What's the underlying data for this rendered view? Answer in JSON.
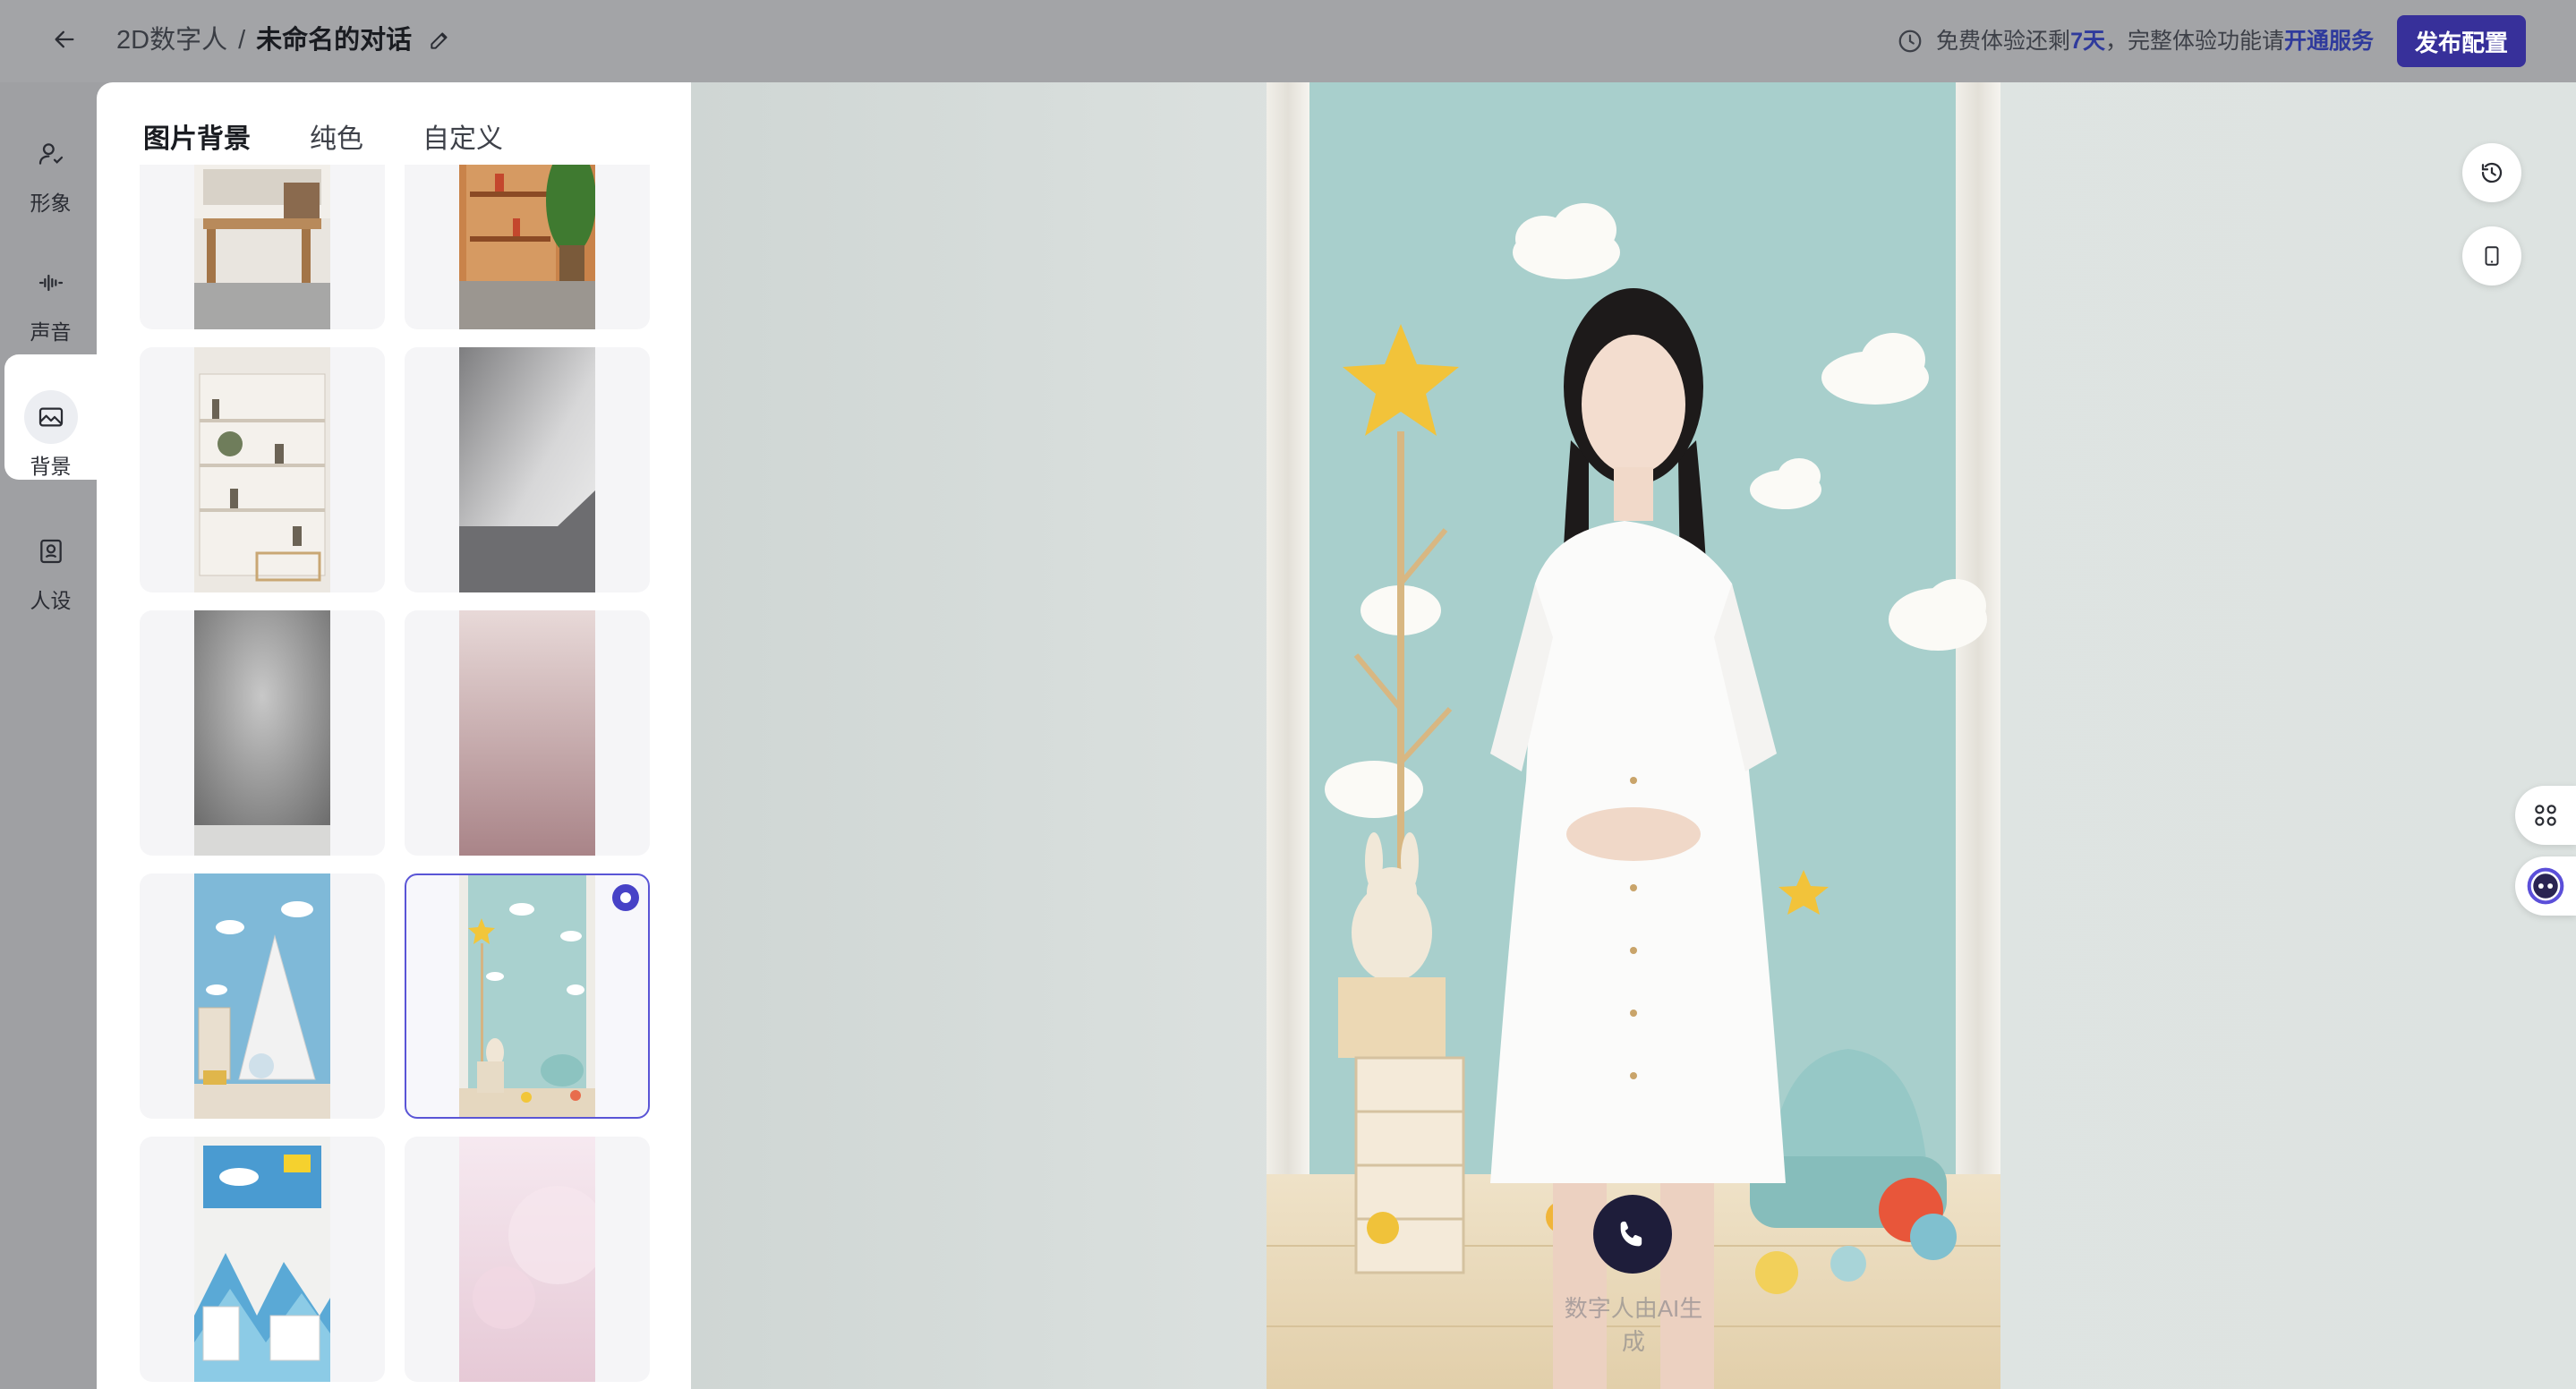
{
  "header": {
    "breadcrumb_parent": "2D数字人",
    "breadcrumb_sep": "/",
    "breadcrumb_current": "未命名的对话",
    "trial_prefix": "免费体验还剩",
    "trial_days": "7天",
    "trial_middle": "，完整体验功能请",
    "trial_link": "开通服务",
    "publish_label": "发布配置"
  },
  "sidebar": {
    "items": [
      {
        "label": "形象",
        "icon": "person-icon"
      },
      {
        "label": "声音",
        "icon": "waveform-icon"
      },
      {
        "label": "背景",
        "icon": "image-icon",
        "active": true
      },
      {
        "label": "人设",
        "icon": "persona-icon"
      }
    ]
  },
  "panel": {
    "tabs": [
      "图片背景",
      "纯色",
      "自定义"
    ],
    "active_tab": "图片背景",
    "selected_background_index": 7,
    "backgrounds": [
      {
        "name": "home-office"
      },
      {
        "name": "bookshelf-plant"
      },
      {
        "name": "white-bookshelf"
      },
      {
        "name": "grey-gradient-fold"
      },
      {
        "name": "grey-studio"
      },
      {
        "name": "pink-gradient"
      },
      {
        "name": "kids-tent-room"
      },
      {
        "name": "kids-mint-room"
      },
      {
        "name": "kids-mountain-room"
      },
      {
        "name": "pink-bokeh"
      }
    ]
  },
  "preview": {
    "ai_note": "数字人由AI生成"
  },
  "colors": {
    "accent": "#37309a",
    "selected_border": "#5a55d6",
    "call_button": "#1e1d3a"
  }
}
